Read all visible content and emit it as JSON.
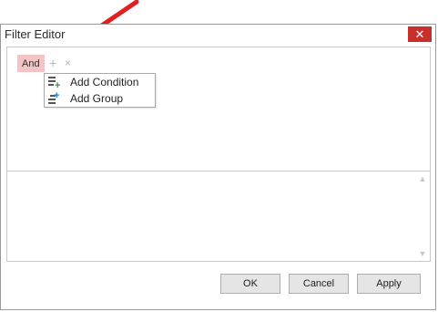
{
  "window": {
    "title": "Filter Editor",
    "close_symbol": "✕"
  },
  "filter": {
    "group_operator": "And",
    "add_symbol": "+",
    "remove_symbol": "×"
  },
  "menu": {
    "items": [
      {
        "label": "Add Condition",
        "icon": "add-condition-icon"
      },
      {
        "label": "Add Group",
        "icon": "add-group-icon"
      }
    ]
  },
  "scrollbar": {
    "up": "▲",
    "down": "▼"
  },
  "buttons": {
    "ok": "OK",
    "cancel": "Cancel",
    "apply": "Apply"
  },
  "colors": {
    "close_button": "#c9302c",
    "and_chip": "#f2c4c4",
    "annotation_arrow": "#e02020",
    "add_icon_green": "#2e9e2e",
    "add_icon_blue": "#1e7fd8"
  }
}
